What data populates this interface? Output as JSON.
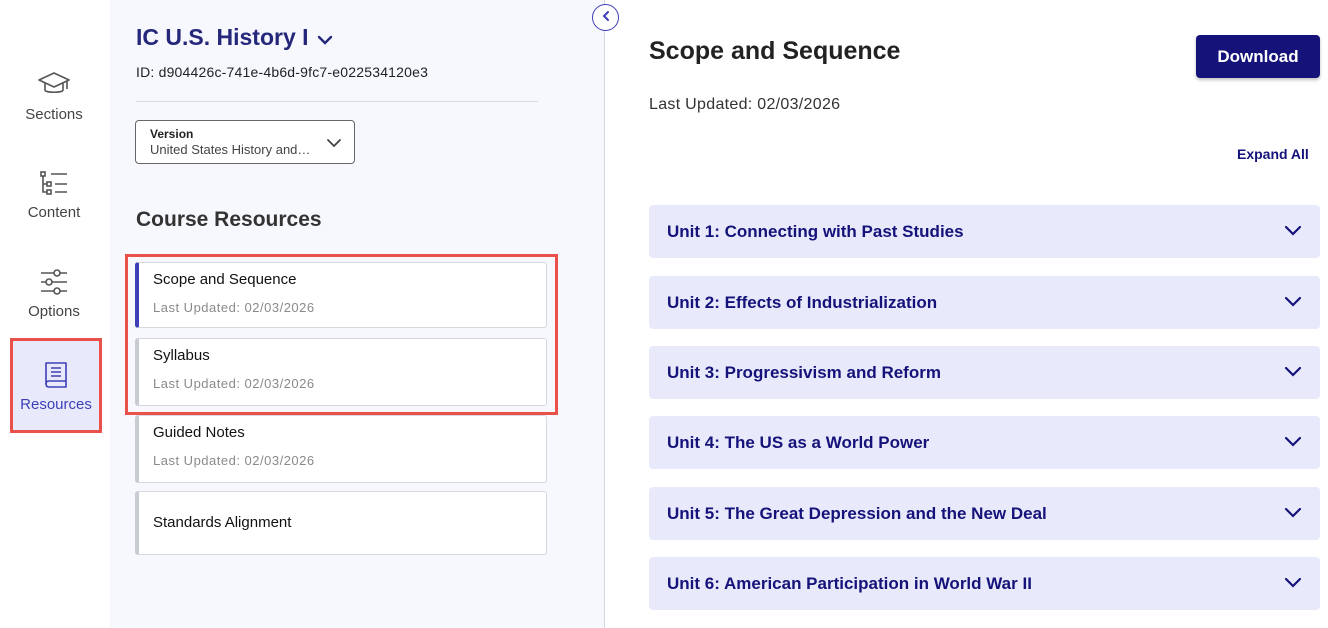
{
  "rail": {
    "items": [
      {
        "label": "Sections",
        "icon": "graduation-cap-icon"
      },
      {
        "label": "Content",
        "icon": "list-tree-icon"
      },
      {
        "label": "Options",
        "icon": "sliders-icon"
      },
      {
        "label": "Resources",
        "icon": "book-icon",
        "active": true
      }
    ]
  },
  "panel": {
    "course_title": "IC U.S. History I",
    "course_id": "ID: d904426c-741e-4b6d-9fc7-e022534120e3",
    "version_label": "Version",
    "version_value": "United States History and Geography",
    "section_heading": "Course Resources",
    "resources": [
      {
        "name": "Scope and Sequence",
        "updated": "Last Updated: 02/03/2026",
        "selected": true
      },
      {
        "name": "Syllabus",
        "updated": "Last Updated: 02/03/2026"
      },
      {
        "name": "Guided Notes",
        "updated": "Last Updated: 02/03/2026"
      },
      {
        "name": "Standards Alignment"
      }
    ]
  },
  "main": {
    "title": "Scope and Sequence",
    "updated": "Last Updated: 02/03/2026",
    "download_label": "Download",
    "expand_all_label": "Expand All",
    "units": [
      {
        "title": "Unit 1: Connecting with Past Studies"
      },
      {
        "title": "Unit 2: Effects of Industrialization"
      },
      {
        "title": "Unit 3: Progressivism and Reform"
      },
      {
        "title": "Unit 4: The US as a World Power"
      },
      {
        "title": "Unit 5: The Great Depression and the New Deal"
      },
      {
        "title": "Unit 6: American Participation in World War II"
      }
    ]
  },
  "colors": {
    "accent": "#3d3fb8",
    "primary_dark": "#15127a",
    "unit_bg": "#e8eafb",
    "highlight_red": "#e9514a"
  }
}
